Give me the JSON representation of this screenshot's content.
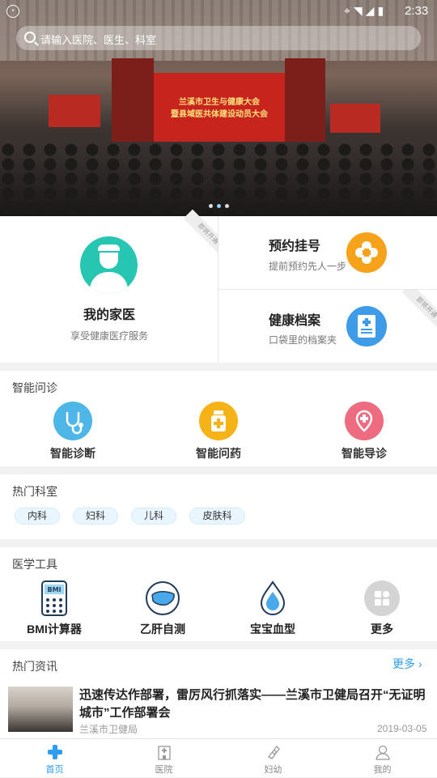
{
  "status": {
    "time": "2:33"
  },
  "search": {
    "placeholder": "请输入医院、医生、科室"
  },
  "banner": {
    "stage_line1": "兰溪市卫生与健康大会",
    "stage_line2": "暨县域医共体建设动员大会"
  },
  "family": {
    "title": "我的家医",
    "subtitle": "享受健康医疗服务",
    "ribbon": "即将开通"
  },
  "appointment": {
    "title": "预约挂号",
    "subtitle": "提前预约先人一步"
  },
  "records": {
    "title": "健康档案",
    "subtitle": "口袋里的档案夹",
    "ribbon": "即将开通"
  },
  "consult": {
    "title": "智能问诊",
    "items": [
      {
        "label": "智能诊断",
        "icon": "stethoscope-icon",
        "color": "#4fb6e8"
      },
      {
        "label": "智能问药",
        "icon": "medicine-bottle-icon",
        "color": "#f5b317"
      },
      {
        "label": "智能导诊",
        "icon": "location-guide-icon",
        "color": "#ef6b7f"
      }
    ]
  },
  "departments": {
    "title": "热门科室",
    "items": [
      "内科",
      "妇科",
      "儿科",
      "皮肤科"
    ]
  },
  "tools": {
    "title": "医学工具",
    "items": [
      {
        "label": "BMI计算器",
        "icon": "bmi-calculator-icon"
      },
      {
        "label": "乙肝自测",
        "icon": "liver-icon"
      },
      {
        "label": "宝宝血型",
        "icon": "blood-drop-icon"
      },
      {
        "label": "更多",
        "icon": "more-grid-icon"
      }
    ]
  },
  "news": {
    "title": "热门资讯",
    "more": "更多",
    "item": {
      "title": "迅速传达作部署，雷厉风行抓落实——兰溪市卫健局召开“无证明城市”工作部署会",
      "source": "兰溪市卫健局",
      "date": "2019-03-05"
    }
  },
  "tabs": [
    {
      "label": "首页",
      "icon": "home-cross-icon",
      "active": true
    },
    {
      "label": "医院",
      "icon": "hospital-icon",
      "active": false
    },
    {
      "label": "妇幼",
      "icon": "mother-baby-icon",
      "active": false
    },
    {
      "label": "我的",
      "icon": "user-icon",
      "active": false
    }
  ],
  "colors": {
    "accent": "#2e9cf0",
    "teal": "#27c6b2",
    "orange": "#f7a21b"
  }
}
